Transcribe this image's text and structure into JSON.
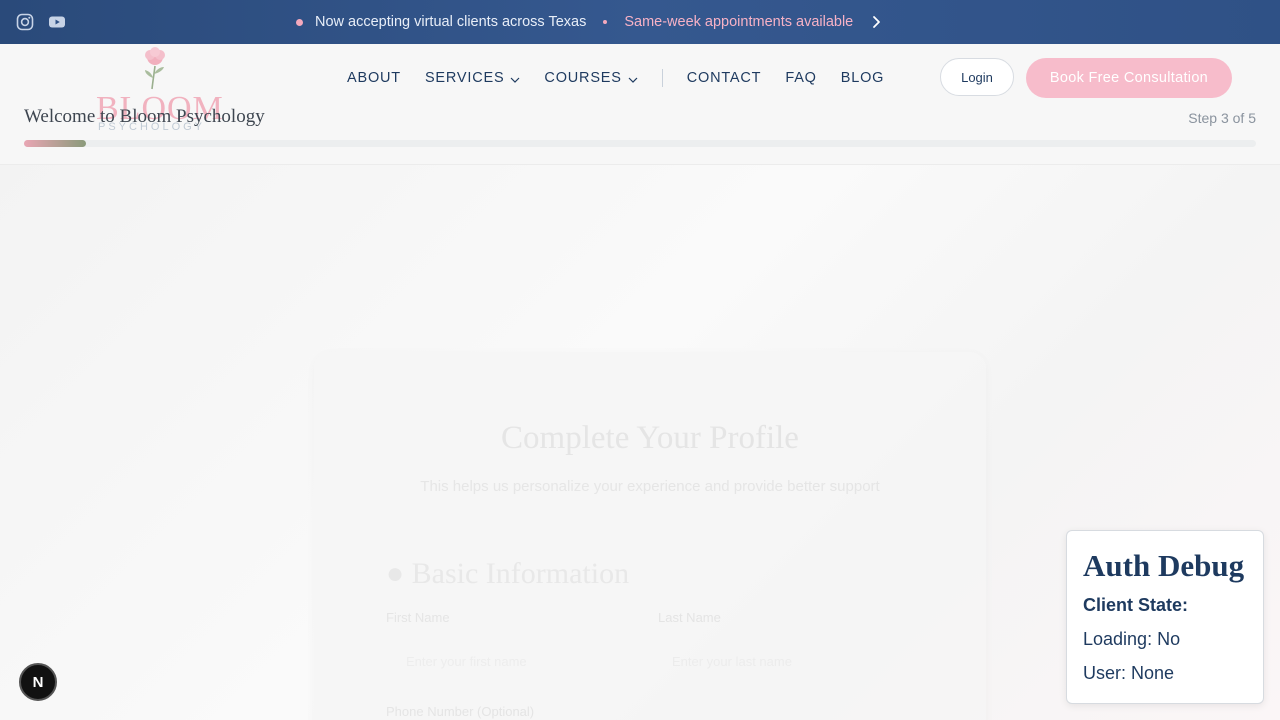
{
  "announcement": {
    "text": "Now accepting virtual clients across Texas",
    "highlight": "Same-week appointments available"
  },
  "social": {
    "icons": [
      "instagram-icon",
      "youtube-icon"
    ]
  },
  "logo": {
    "wordmark": "BLOOM",
    "subword": "PSYCHOLOGY"
  },
  "nav": {
    "about": "ABOUT",
    "services": "SERVICES",
    "courses": "COURSES",
    "contact": "CONTACT",
    "faq": "FAQ",
    "blog": "BLOG"
  },
  "header": {
    "login": "Login",
    "book": "Book Free Consultation"
  },
  "progress": {
    "welcome": "Welcome to Bloom Psychology",
    "step": "Step 3 of 5",
    "fraction": 0.05
  },
  "profile": {
    "title": "Complete Your Profile",
    "subtitle": "This helps us personalize your experience and provide better support",
    "section": "Basic Information",
    "first_name_label": "First Name",
    "last_name_label": "Last Name",
    "first_name_placeholder": "Enter your first name",
    "last_name_placeholder": "Enter your last name",
    "phone_label": "Phone Number (Optional)"
  },
  "debug": {
    "title": "Auth Debug",
    "client_state": "Client State:",
    "loading": "Loading: No",
    "user": "User: None"
  },
  "badge": {
    "letter": "N"
  },
  "colors": {
    "brand_navy": "#1e3a5f",
    "brand_pink": "#f7bccb",
    "topbar": "#2f5186"
  }
}
